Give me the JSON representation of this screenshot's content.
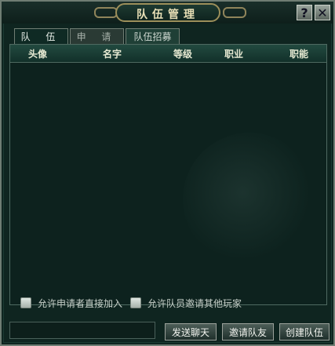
{
  "window": {
    "title": "队伍管理"
  },
  "tabs": [
    {
      "label": "队 伍"
    },
    {
      "label": "申 请"
    },
    {
      "label": "队伍招募"
    }
  ],
  "table": {
    "columns": [
      "头像",
      "名字",
      "等级",
      "职业",
      "职能"
    ],
    "rows": []
  },
  "options": {
    "allow_direct_join": "允许申请者直接加入",
    "allow_member_invite": "允许队员邀请其他玩家"
  },
  "chat": {
    "placeholder": ""
  },
  "buttons": {
    "send_chat": "发送聊天",
    "invite": "邀请队友",
    "create_team": "创建队伍"
  },
  "icons": {
    "help": "help-icon",
    "close": "close-icon"
  }
}
